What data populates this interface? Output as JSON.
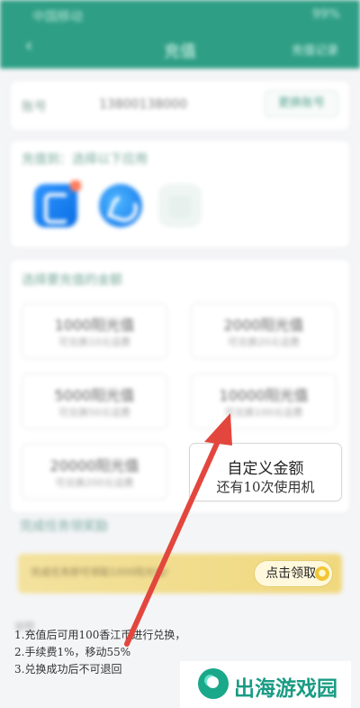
{
  "status_bar": {
    "left": "中国移动",
    "right": "99%"
  },
  "header": {
    "title": "充值",
    "right_label": "充值记录"
  },
  "account": {
    "label": "账号",
    "value": "13800138000",
    "button": "更换账号"
  },
  "apps_section": {
    "title": "充值到：选择以下应用"
  },
  "amount_section": {
    "title": "选择要充值的金额",
    "options": [
      {
        "amount": "1000阳光值",
        "desc": "可兑换10元话费"
      },
      {
        "amount": "2000阳光值",
        "desc": "可兑换20元话费"
      },
      {
        "amount": "5000阳光值",
        "desc": "可兑换50元话费"
      },
      {
        "amount": "10000阳光值",
        "desc": "可兑换100元话费"
      },
      {
        "amount": "20000阳光值",
        "desc": "可兑换200元话费"
      }
    ],
    "custom": {
      "title": "自定义金额",
      "subtitle": "还有10次使用机"
    }
  },
  "promo": {
    "title": "完成任务领奖励",
    "banner_text": "完成任务即可领取1000阳光值!",
    "button": "点击领取!"
  },
  "notice": {
    "label": "说明",
    "line1": "1.充值后可用100香江币进行兑换，",
    "line2": "2.手续费1%，移动55%",
    "line3": "3.兑换成功后不可退回"
  },
  "watermark": {
    "text": "出海游戏园"
  },
  "colors": {
    "brand": "#2E9E84",
    "banner": "#F1DC86",
    "arrow": "#E3463D"
  }
}
